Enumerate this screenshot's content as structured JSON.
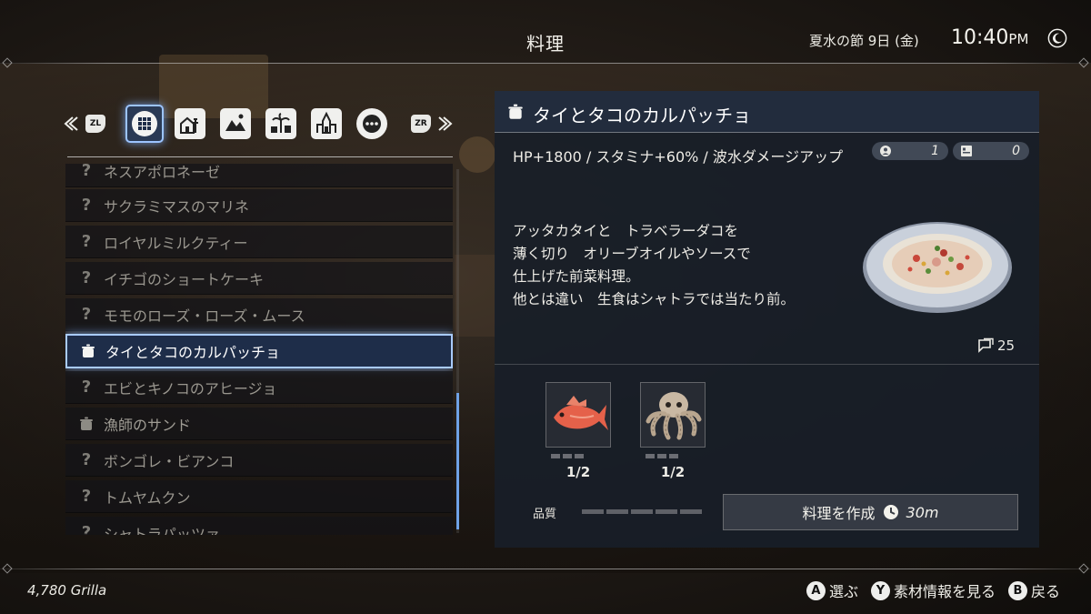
{
  "header": {
    "title": "料理",
    "date": "夏水の節 9日 (金)",
    "time": "10:40",
    "ampm": "PM"
  },
  "categories": {
    "left_button": "ZL",
    "right_button": "ZR",
    "icons": [
      "all-grid-icon",
      "village-icon",
      "landscape-icon",
      "palm-town-icon",
      "castle-icon",
      "other-dots-icon"
    ],
    "active_index": 0
  },
  "recipes": {
    "items": [
      {
        "label": "ネスアポロネーゼ",
        "known": false
      },
      {
        "label": "サクラミマスのマリネ",
        "known": false
      },
      {
        "label": "ロイヤルミルクティー",
        "known": false
      },
      {
        "label": "イチゴのショートケーキ",
        "known": false
      },
      {
        "label": "モモのローズ・ローズ・ムース",
        "known": false
      },
      {
        "label": "タイとタコのカルパッチョ",
        "known": true,
        "selected": true
      },
      {
        "label": "エビとキノコのアヒージョ",
        "known": false
      },
      {
        "label": "漁師のサンド",
        "known": true
      },
      {
        "label": "ボンゴレ・ビアンコ",
        "known": false
      },
      {
        "label": "トムヤムクン",
        "known": false
      },
      {
        "label": "シャトラパッツァ",
        "known": false
      }
    ],
    "unknown_mark": "?"
  },
  "detail": {
    "title": "タイとタコのカルパッチョ",
    "effect": "HP+1800 / スタミナ+60% / 波水ダメージアップ",
    "description": [
      "アッタカタイと　トラベラーダコを",
      "薄く切り　オリーブオイルやソースで",
      "仕上げた前菜料理。",
      "他とは違い　生食はシャトラでは当たり前。"
    ],
    "stat_party": "1",
    "stat_stock": "0",
    "made_count": "25",
    "ingredients": [
      {
        "name": "red-fish-icon",
        "qty": "1/2"
      },
      {
        "name": "octopus-icon",
        "qty": "1/2"
      }
    ],
    "quality_label": "品質",
    "cook_label": "料理を作成",
    "cook_time": "30m"
  },
  "footer": {
    "money": "4,780 Grilla",
    "hints": [
      {
        "button": "A",
        "label": "選ぶ"
      },
      {
        "button": "Y",
        "label": "素材情報を見る"
      },
      {
        "button": "B",
        "label": "戻る"
      }
    ]
  },
  "colors": {
    "accent": "#a9cbff",
    "panel": "#181e28",
    "text": "#eeece6"
  }
}
